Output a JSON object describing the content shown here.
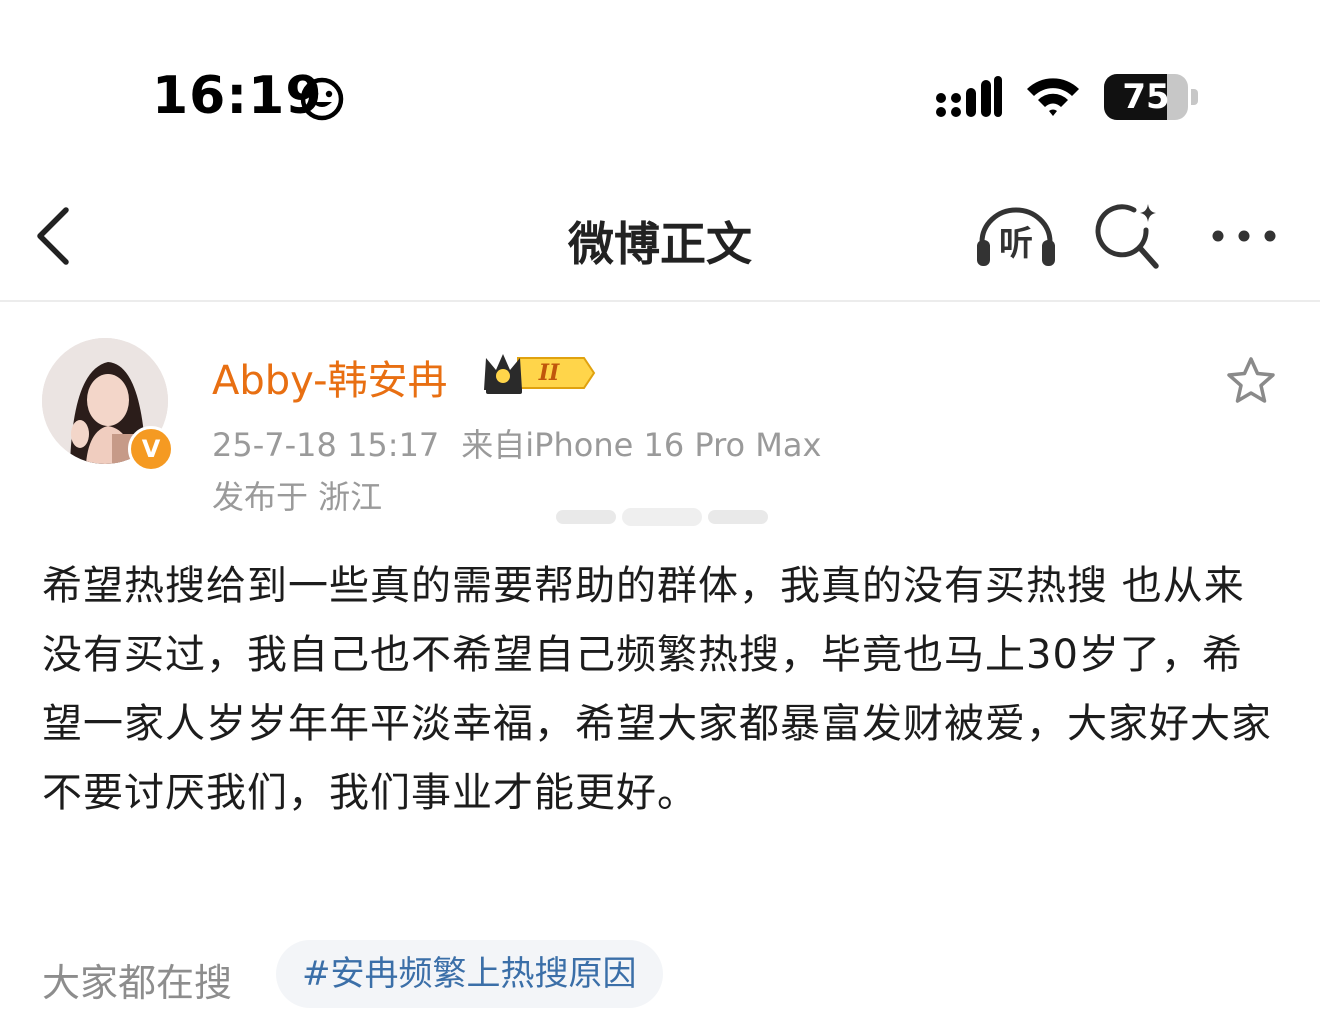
{
  "status_bar": {
    "time": "16:19",
    "battery_percent": "75",
    "battery_level": 0.75,
    "icons": [
      "smiley-face-icon",
      "cellular-signal-icon",
      "wifi-icon",
      "battery-icon"
    ]
  },
  "nav": {
    "title": "微博正文",
    "listen_label": "听",
    "icons": [
      "back-arrow-icon",
      "headphones-icon",
      "search-sparkle-icon",
      "more-dots-icon"
    ]
  },
  "post": {
    "author_name": "Abby-韩安冉",
    "vip_level": "II",
    "verified_badge": "V",
    "timestamp": "25-7-18 15:17",
    "source": "来自iPhone 16 Pro Max",
    "location": "发布于 浙江",
    "text": "希望热搜给到一些真的需要帮助的群体，我真的没有买热搜 也从来没有买过，我自己也不希望自己频繁热搜，毕竟也马上30岁了，希望一家人岁岁年年平淡幸福，希望大家都暴富发财被爱，大家好大家不要讨厌我们，我们事业才能更好。"
  },
  "footer": {
    "search_hint": "大家都在搜",
    "topic": "#安冉频繁上热搜原因"
  },
  "colors": {
    "author_name": "#e86f12",
    "verified": "#f59a22",
    "topic": "#3b6fa8",
    "meta": "#9a9a9a"
  }
}
